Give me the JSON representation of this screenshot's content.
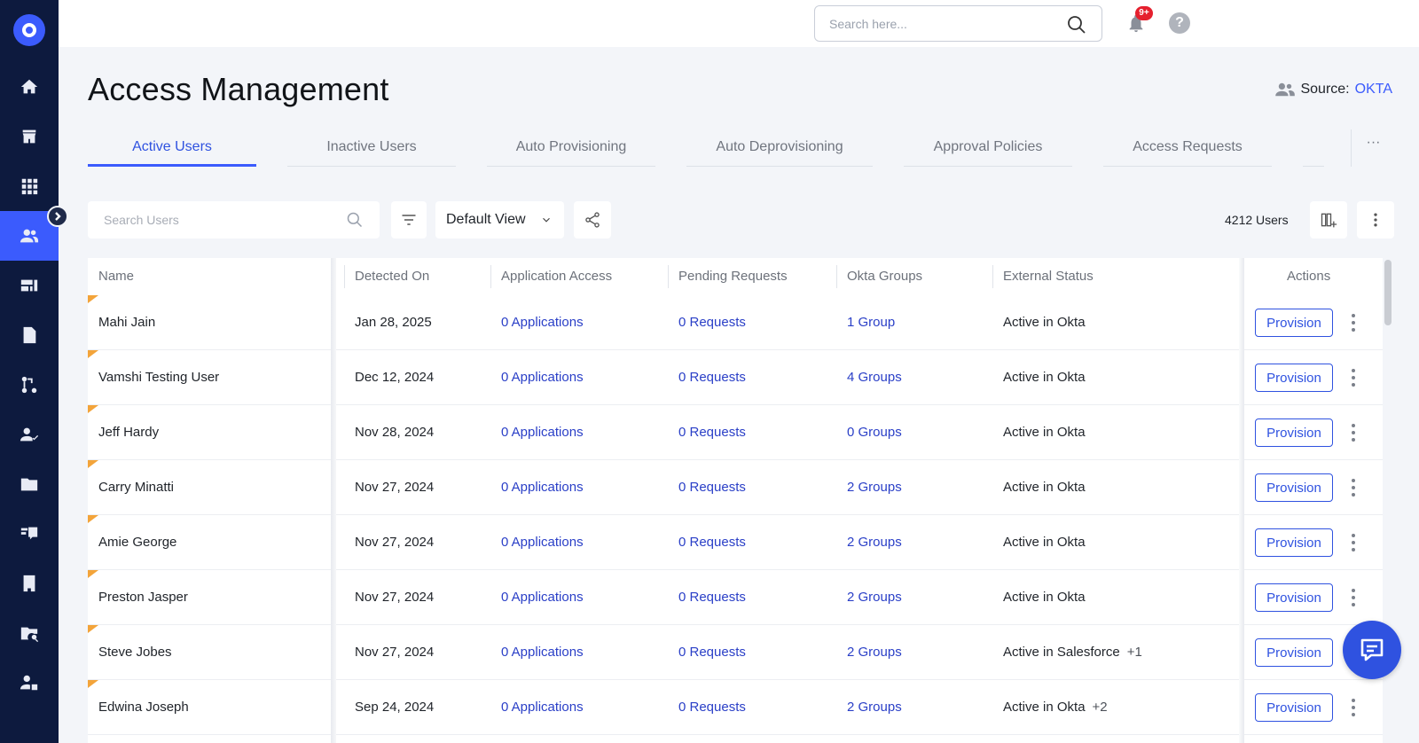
{
  "topbar": {
    "search_placeholder": "Search here...",
    "notification_badge": "9+",
    "help_label": "?"
  },
  "page": {
    "title": "Access Management",
    "source_label": "Source: ",
    "source_value": "OKTA"
  },
  "tabs": [
    {
      "label": "Active Users",
      "active": true
    },
    {
      "label": "Inactive Users",
      "active": false
    },
    {
      "label": "Auto Provisioning",
      "active": false
    },
    {
      "label": "Auto Deprovisioning",
      "active": false
    },
    {
      "label": "Approval Policies",
      "active": false
    },
    {
      "label": "Access Requests",
      "active": false
    }
  ],
  "tab_more_label": "···",
  "toolbar": {
    "search_placeholder": "Search Users",
    "view_label": "Default View",
    "user_count": "4212 Users"
  },
  "table": {
    "headers": {
      "name": "Name",
      "detected_on": "Detected On",
      "application_access": "Application Access",
      "pending_requests": "Pending Requests",
      "okta_groups": "Okta Groups",
      "external_status": "External Status",
      "actions": "Actions"
    },
    "action_label": "Provision",
    "rows": [
      {
        "name": "Mahi Jain",
        "detected": "Jan 28, 2025",
        "apps": "0 Applications",
        "requests": "0 Requests",
        "groups": "1 Group",
        "status": "Active in Okta",
        "extra": ""
      },
      {
        "name": "Vamshi Testing User",
        "detected": "Dec 12, 2024",
        "apps": "0 Applications",
        "requests": "0 Requests",
        "groups": "4 Groups",
        "status": "Active in Okta",
        "extra": ""
      },
      {
        "name": "Jeff Hardy",
        "detected": "Nov 28, 2024",
        "apps": "0 Applications",
        "requests": "0 Requests",
        "groups": "0 Groups",
        "status": "Active in Okta",
        "extra": ""
      },
      {
        "name": "Carry Minatti",
        "detected": "Nov 27, 2024",
        "apps": "0 Applications",
        "requests": "0 Requests",
        "groups": "2 Groups",
        "status": "Active in Okta",
        "extra": ""
      },
      {
        "name": "Amie George",
        "detected": "Nov 27, 2024",
        "apps": "0 Applications",
        "requests": "0 Requests",
        "groups": "2 Groups",
        "status": "Active in Okta",
        "extra": ""
      },
      {
        "name": "Preston Jasper",
        "detected": "Nov 27, 2024",
        "apps": "0 Applications",
        "requests": "0 Requests",
        "groups": "2 Groups",
        "status": "Active in Okta",
        "extra": ""
      },
      {
        "name": "Steve Jobes",
        "detected": "Nov 27, 2024",
        "apps": "0 Applications",
        "requests": "0 Requests",
        "groups": "2 Groups",
        "status": "Active in Salesforce",
        "extra": "+1"
      },
      {
        "name": "Edwina Joseph",
        "detected": "Sep 24, 2024",
        "apps": "0 Applications",
        "requests": "0 Requests",
        "groups": "2 Groups",
        "status": "Active in Okta",
        "extra": "+2"
      }
    ]
  },
  "sidebar": {
    "items": [
      "home-icon",
      "store-icon",
      "apps-grid-icon",
      "users-icon",
      "dashboard-icon",
      "document-icon",
      "workflow-icon",
      "user-check-icon",
      "folder-icon",
      "feedback-icon",
      "building-icon",
      "folder-search-icon",
      "user-settings-icon"
    ],
    "active_index": 3
  },
  "colors": {
    "sidebar_bg": "#0d1a3e",
    "accent": "#3b5bfd",
    "link": "#2a3fc7",
    "flag": "#f3a43a",
    "badge": "#e5202e"
  }
}
